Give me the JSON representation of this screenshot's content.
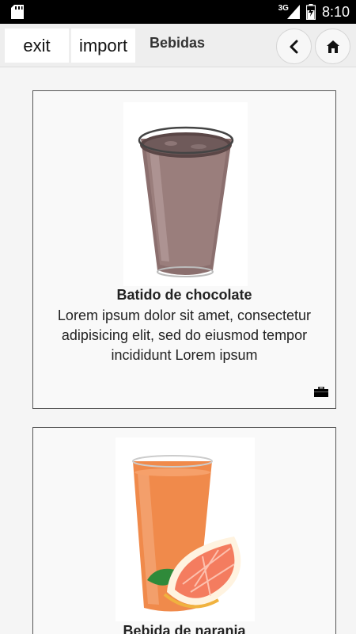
{
  "status_bar": {
    "network": "3G",
    "time": "8:10",
    "icons": [
      "sd-card-icon",
      "signal-icon",
      "battery-icon"
    ]
  },
  "app_bar": {
    "exit_label": "exit",
    "import_label": "import",
    "title": "Bebidas",
    "back_icon": "chevron-left-icon",
    "home_icon": "home-icon"
  },
  "items": [
    {
      "title": "Batido de chocolate",
      "description": "Lorem ipsum dolor sit amet, consectetur adipisicing elit, sed do eiusmod tempor incididunt Lorem ipsum",
      "image": "chocolate-milkshake-glass",
      "action_icon": "briefcase-icon"
    },
    {
      "title": "Bebida de naranja",
      "image": "orange-juice-glass"
    }
  ],
  "colors": {
    "status_bar": "#000000",
    "app_bar": "#eeeeee",
    "background": "#f5f5f5",
    "card_border": "#555555"
  }
}
